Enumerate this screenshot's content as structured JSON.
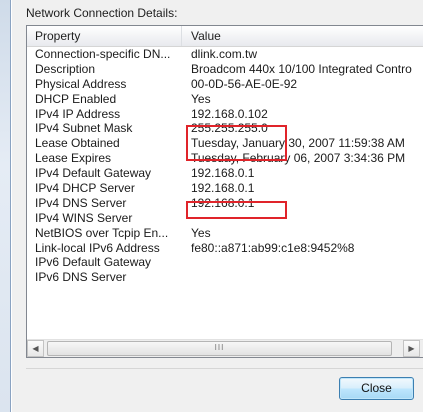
{
  "dialog": {
    "caption": "Network Connection Details:",
    "close_label": "Close"
  },
  "listview": {
    "columns": [
      "Property",
      "Value"
    ],
    "rows": [
      {
        "property": "Connection-specific DN...",
        "value": "dlink.com.tw"
      },
      {
        "property": "Description",
        "value": "Broadcom 440x 10/100 Integrated Contro"
      },
      {
        "property": "Physical Address",
        "value": "00-0D-56-AE-0E-92"
      },
      {
        "property": "DHCP Enabled",
        "value": "Yes"
      },
      {
        "property": "IPv4 IP Address",
        "value": "192.168.0.102"
      },
      {
        "property": "IPv4 Subnet Mask",
        "value": "255.255.255.0"
      },
      {
        "property": "Lease Obtained",
        "value": "Tuesday, January 30, 2007 11:59:38 AM"
      },
      {
        "property": "Lease Expires",
        "value": "Tuesday, February 06, 2007 3:34:36 PM"
      },
      {
        "property": "IPv4 Default Gateway",
        "value": "192.168.0.1"
      },
      {
        "property": "IPv4 DHCP Server",
        "value": "192.168.0.1"
      },
      {
        "property": "IPv4 DNS Server",
        "value": "192.168.0.1"
      },
      {
        "property": "IPv4 WINS Server",
        "value": ""
      },
      {
        "property": "NetBIOS over Tcpip En...",
        "value": "Yes"
      },
      {
        "property": "Link-local IPv6 Address",
        "value": "fe80::a871:ab99:c1e8:9452%8"
      },
      {
        "property": "IPv6 Default Gateway",
        "value": ""
      },
      {
        "property": "IPv6 DNS Server",
        "value": ""
      }
    ],
    "scroll_thumb_grip": "III"
  },
  "colors": {
    "highlight_box": "#e0242a",
    "button_border": "#3c7fb1"
  }
}
